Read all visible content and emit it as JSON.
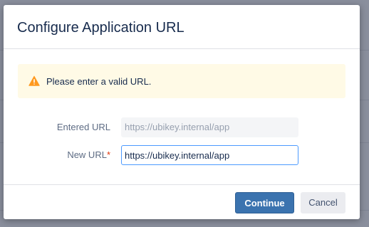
{
  "dialog": {
    "title": "Configure Application URL",
    "warning": {
      "icon": "warning-icon",
      "text": "Please enter a valid URL."
    },
    "fields": {
      "entered_url": {
        "label": "Entered URL",
        "value": "https://ubikey.internal/app"
      },
      "new_url": {
        "label": "New URL",
        "required_marker": "*",
        "value": "https://ubikey.internal/app"
      }
    },
    "buttons": {
      "continue": "Continue",
      "cancel": "Cancel"
    }
  },
  "colors": {
    "primary": "#3b73af",
    "warning_bg": "#fffae6",
    "warning_icon": "#ff991f",
    "required": "#de350b"
  }
}
